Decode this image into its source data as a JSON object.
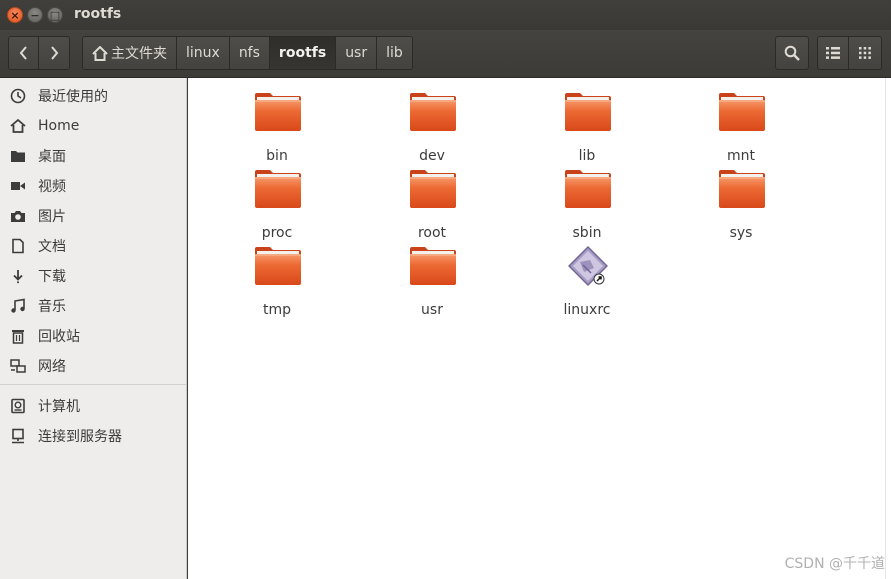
{
  "window": {
    "title": "rootfs",
    "controls": {
      "close": "×",
      "minimize": "−",
      "maximize": "□"
    }
  },
  "toolbar": {
    "breadcrumbs": [
      "主文件夹",
      "linux",
      "nfs",
      "rootfs",
      "usr",
      "lib"
    ],
    "active_crumb": "rootfs",
    "buttons": [
      "back",
      "forward",
      "search",
      "list-view",
      "grid-view"
    ]
  },
  "sidebar": {
    "items": [
      {
        "label": "最近使用的",
        "icon": "clock-icon"
      },
      {
        "label": "Home",
        "icon": "home-icon"
      },
      {
        "label": "桌面",
        "icon": "desktop-folder-icon"
      },
      {
        "label": "视频",
        "icon": "video-icon"
      },
      {
        "label": "图片",
        "icon": "camera-icon"
      },
      {
        "label": "文档",
        "icon": "document-icon"
      },
      {
        "label": "下载",
        "icon": "download-icon"
      },
      {
        "label": "音乐",
        "icon": "music-icon"
      },
      {
        "label": "回收站",
        "icon": "trash-icon"
      },
      {
        "label": "网络",
        "icon": "network-icon"
      }
    ],
    "devices": [
      {
        "label": "计算机",
        "icon": "computer-icon"
      },
      {
        "label": "连接到服务器",
        "icon": "server-icon"
      }
    ]
  },
  "files": [
    {
      "name": "bin",
      "type": "folder"
    },
    {
      "name": "dev",
      "type": "folder"
    },
    {
      "name": "lib",
      "type": "folder"
    },
    {
      "name": "mnt",
      "type": "folder"
    },
    {
      "name": "proc",
      "type": "folder"
    },
    {
      "name": "root",
      "type": "folder"
    },
    {
      "name": "sbin",
      "type": "folder"
    },
    {
      "name": "sys",
      "type": "folder"
    },
    {
      "name": "tmp",
      "type": "folder"
    },
    {
      "name": "usr",
      "type": "folder"
    },
    {
      "name": "linuxrc",
      "type": "symlink-executable"
    }
  ],
  "watermark": "CSDN @千千道",
  "colors": {
    "folder_orange": "#e95420",
    "toolbar_bg": "#3c3b37",
    "sidebar_bg": "#eeedeb"
  }
}
